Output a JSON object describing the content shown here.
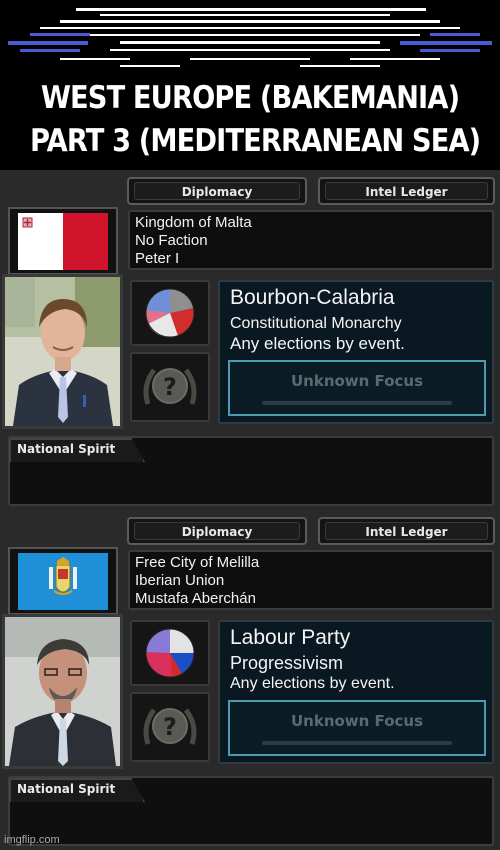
{
  "header": {
    "title_line1": "WEST EUROPE (BAKEMANIA)",
    "title_line2": "PART 3 (MEDITERRANEAN SEA)"
  },
  "panels": [
    {
      "tabs": {
        "diplomacy": "Diplomacy",
        "intel": "Intel Ledger"
      },
      "flag_icon": "malta-flag",
      "country": "Kingdom of Malta",
      "faction": "No Faction",
      "leader": "Peter I",
      "party": "Bourbon-Calabria",
      "ideology": "Constitutional Monarchy",
      "elections": "Any elections by event.",
      "focus": "Unknown Focus",
      "national_spirit": "National Spirit",
      "pie_icon": "party-popularity-pie",
      "focus_icon": "unknown-focus-question-icon"
    },
    {
      "tabs": {
        "diplomacy": "Diplomacy",
        "intel": "Intel Ledger"
      },
      "flag_icon": "melilla-flag",
      "country": "Free City of Melilla",
      "faction": "Iberian Union",
      "leader": "Mustafa Aberchán",
      "party": "Labour Party",
      "ideology": "Progressivism",
      "elections": "Any elections by event.",
      "focus": "Unknown Focus",
      "national_spirit": "National Spirit",
      "pie_icon": "party-popularity-pie",
      "focus_icon": "unknown-focus-question-icon"
    }
  ],
  "watermark": "imgflip.com",
  "colors": {
    "malta_red": "#cf142b",
    "melilla_blue": "#1f8fd8",
    "focus_border": "#4c9bb0"
  }
}
